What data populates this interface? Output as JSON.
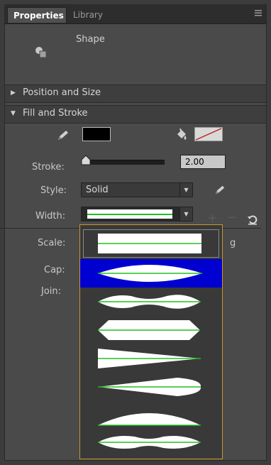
{
  "tabs": [
    {
      "label": "Properties",
      "active": true
    },
    {
      "label": "Library",
      "active": false
    }
  ],
  "shape": {
    "label": "Shape"
  },
  "sections": {
    "position_size": "Position and Size",
    "fill_stroke": "Fill and Stroke"
  },
  "fill_stroke": {
    "fill_color": "#000000",
    "stroke_color": "none",
    "stroke_label": "Stroke:",
    "stroke_value": "2.00",
    "style_label": "Style:",
    "style_value": "Solid",
    "width_label": "Width:",
    "scale_label": "Scale:",
    "scale_tail": "g",
    "cap_label": "Cap:",
    "join_label": "Join:"
  },
  "icons": {
    "panel_menu": "panel-menu-icon",
    "shape": "shape-icon",
    "stroke_pencil": "pencil-icon",
    "fill_bucket": "paint-bucket-icon",
    "style_pencil": "pencil-icon",
    "add": "plus-icon",
    "remove": "minus-icon",
    "reset": "reset-icon"
  },
  "colors": {
    "accent_selected": "#0000d0",
    "dropdown_border": "#c8962a",
    "profile_line": "#22c022"
  },
  "width_profiles": [
    {
      "name": "uniform",
      "selected": false
    },
    {
      "name": "bulge-ellipse",
      "selected": true
    },
    {
      "name": "pinched-middle",
      "selected": false
    },
    {
      "name": "hexagon-tapered",
      "selected": false
    },
    {
      "name": "taper-right",
      "selected": false
    },
    {
      "name": "taper-left-bulge",
      "selected": false
    },
    {
      "name": "arch-top",
      "selected": false
    },
    {
      "name": "double-bulge",
      "selected": false
    }
  ]
}
